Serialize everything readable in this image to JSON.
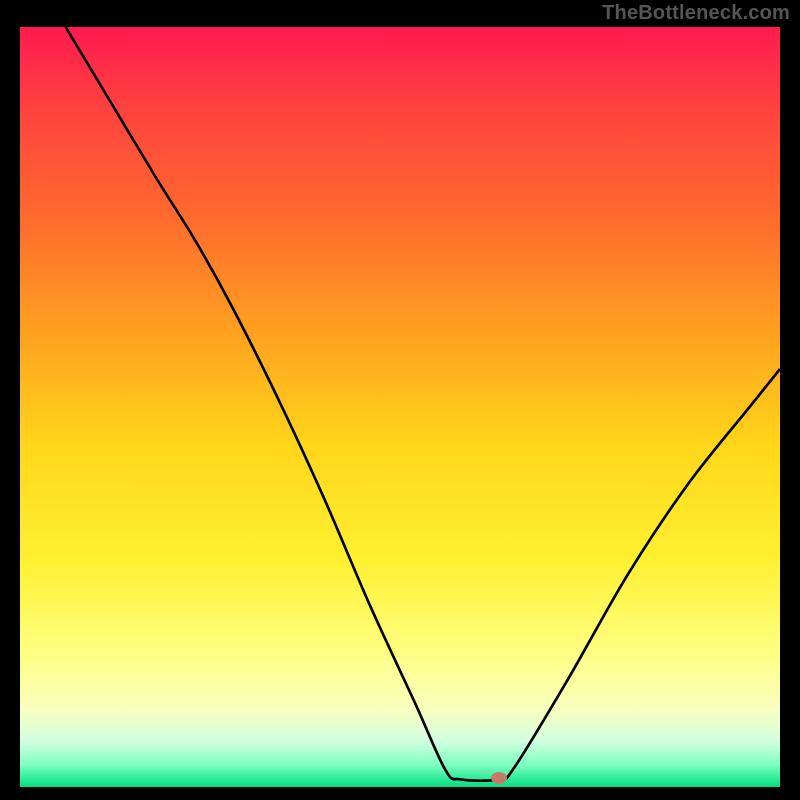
{
  "attribution": "TheBottleneck.com",
  "chart_data": {
    "type": "line",
    "title": "",
    "xlabel": "",
    "ylabel": "",
    "xlim": [
      0,
      100
    ],
    "ylim": [
      0,
      100
    ],
    "series": [
      {
        "name": "bottleneck-curve",
        "points": [
          {
            "x": 6,
            "y": 100
          },
          {
            "x": 12,
            "y": 90
          },
          {
            "x": 18,
            "y": 80
          },
          {
            "x": 23,
            "y": 72
          },
          {
            "x": 28,
            "y": 63
          },
          {
            "x": 34,
            "y": 51
          },
          {
            "x": 40,
            "y": 38
          },
          {
            "x": 46,
            "y": 24
          },
          {
            "x": 52,
            "y": 11
          },
          {
            "x": 56,
            "y": 2.2
          },
          {
            "x": 58,
            "y": 1.0
          },
          {
            "x": 63,
            "y": 1.0
          },
          {
            "x": 65,
            "y": 2.5
          },
          {
            "x": 72,
            "y": 14
          },
          {
            "x": 80,
            "y": 28
          },
          {
            "x": 88,
            "y": 40
          },
          {
            "x": 96,
            "y": 50
          },
          {
            "x": 100,
            "y": 55
          }
        ]
      }
    ],
    "marker": {
      "x": 63,
      "y": 1.2
    }
  }
}
